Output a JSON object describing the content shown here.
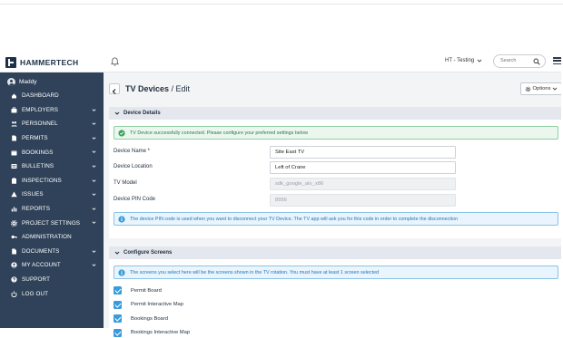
{
  "header": {
    "logo_text": "HAMMERTECH",
    "company": "HT - Testing",
    "search_placeholder": "Search"
  },
  "sidebar": {
    "user_name": "Maddy",
    "items": [
      {
        "label": "DASHBOARD",
        "icon": "home-icon",
        "expandable": false
      },
      {
        "label": "EMPLOYERS",
        "icon": "briefcase-icon",
        "expandable": true
      },
      {
        "label": "PERSONNEL",
        "icon": "users-icon",
        "expandable": true
      },
      {
        "label": "PERMITS",
        "icon": "file-icon",
        "expandable": true
      },
      {
        "label": "BOOKINGS",
        "icon": "calendar-icon",
        "expandable": true
      },
      {
        "label": "BULLETINS",
        "icon": "bulletin-icon",
        "expandable": true
      },
      {
        "label": "INSPECTIONS",
        "icon": "clipboard-icon",
        "expandable": true
      },
      {
        "label": "ISSUES",
        "icon": "warning-icon",
        "expandable": true
      },
      {
        "label": "REPORTS",
        "icon": "chart-icon",
        "expandable": true
      },
      {
        "label": "PROJECT SETTINGS",
        "icon": "gear-icon",
        "expandable": true
      },
      {
        "label": "ADMINISTRATION",
        "icon": "key-icon",
        "expandable": false
      },
      {
        "label": "DOCUMENTS",
        "icon": "document-icon",
        "expandable": true
      },
      {
        "label": "MY ACCOUNT",
        "icon": "account-icon",
        "expandable": true
      },
      {
        "label": "SUPPORT",
        "icon": "help-icon",
        "expandable": false
      },
      {
        "label": "LOG OUT",
        "icon": "power-icon",
        "expandable": false
      }
    ]
  },
  "page": {
    "title_bold": "TV Devices",
    "title_rest": " / Edit",
    "options_label": "Options"
  },
  "device_details": {
    "heading": "Device Details",
    "success_message": "TV Device successfully connected. Please configure your preferred settings below",
    "fields": {
      "name": {
        "label": "Device Name *",
        "value": "Site East TV"
      },
      "location": {
        "label": "Device Location",
        "value": "Left of Crane"
      },
      "model": {
        "label": "TV Model",
        "value": "sdk_google_atv_x86"
      },
      "pin": {
        "label": "Device PIN Code",
        "value": "8956"
      }
    },
    "info_message": "The device PIN code is used when you want to disconnect your TV Device. The TV app will ask you for this code in order to complete the disconnection"
  },
  "configure_screens": {
    "heading": "Configure Screens",
    "info_message": "The screens you select here will be the screens shown in the TV rotation. You must have at least 1 screen selected",
    "screens": [
      {
        "label": "Permit Board",
        "checked": true
      },
      {
        "label": "Permit Interactive Map",
        "checked": true
      },
      {
        "label": "Bookings Board",
        "checked": true
      },
      {
        "label": "Bookings Interactive Map",
        "checked": true
      }
    ]
  },
  "colors": {
    "sidebar_bg": "#2f4259",
    "accent_blue": "#3a9bdc",
    "success_green": "#2d7a43",
    "info_blue": "#2277b8"
  }
}
